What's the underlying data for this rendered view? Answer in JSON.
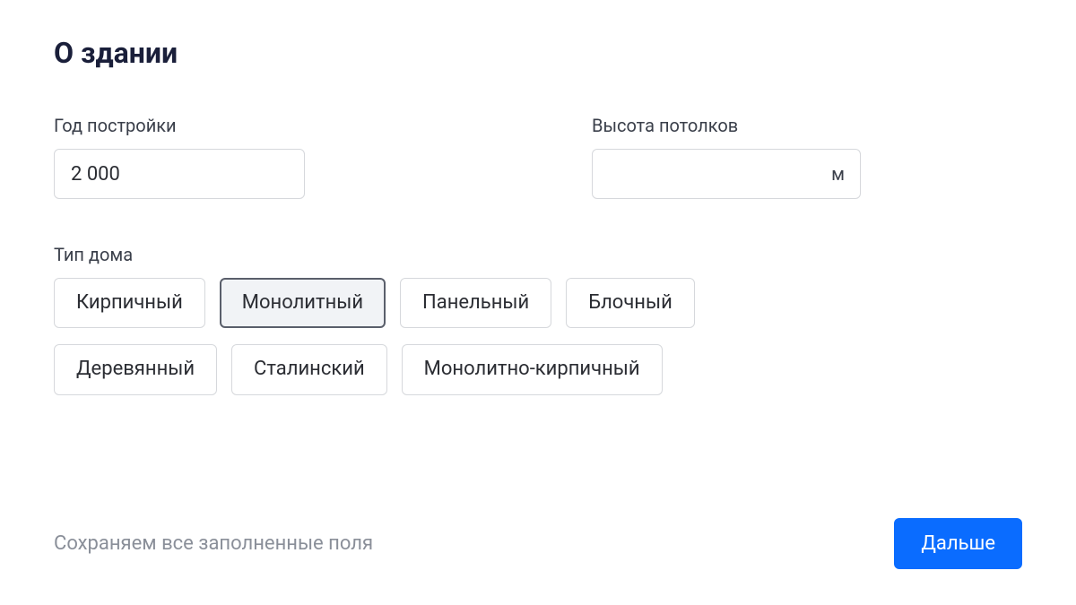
{
  "section": {
    "title": "О здании"
  },
  "yearBuilt": {
    "label": "Год постройки",
    "value": "2 000"
  },
  "ceilingHeight": {
    "label": "Высота потолков",
    "value": "",
    "unit": "м"
  },
  "houseType": {
    "label": "Тип дома",
    "options": [
      "Кирпичный",
      "Монолитный",
      "Панельный",
      "Блочный",
      "Деревянный",
      "Сталинский",
      "Монолитно-кирпичный"
    ],
    "selectedIndex": 1
  },
  "footer": {
    "saveNote": "Сохраняем все заполненные поля",
    "nextLabel": "Дальше"
  }
}
